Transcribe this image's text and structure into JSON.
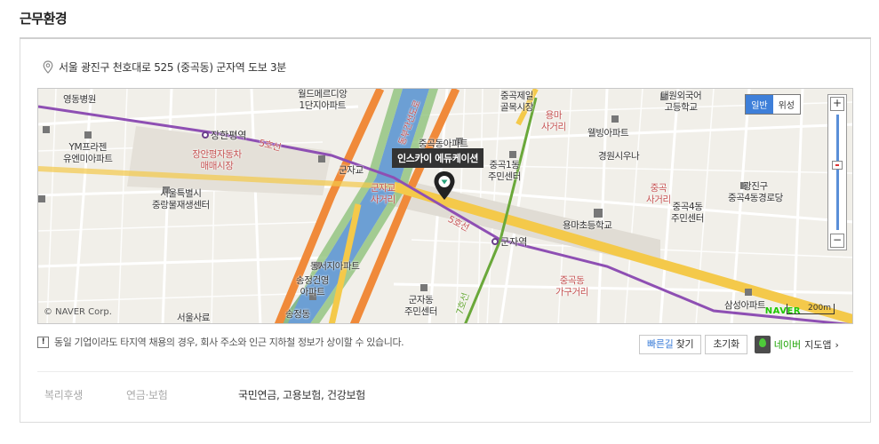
{
  "section": {
    "title": "근무환경"
  },
  "location": {
    "address": "서울 광진구 천호대로 525 (중곡동) 군자역 도보 3분"
  },
  "map": {
    "marker_label": "인스카이 에듀케이션",
    "copyright": "© NAVER Corp.",
    "map_type": {
      "normal": "일반",
      "satellite": "위성"
    },
    "zoom": {
      "plus": "+",
      "minus": "−"
    },
    "logo": "NAVER",
    "scale": "200m",
    "line_label": "5호선",
    "line_label_2": "7호선",
    "road_label": "동부간선도로",
    "pois": [
      {
        "text": "영동병원"
      },
      {
        "text": "YM프라젠\n유엔미아파트"
      },
      {
        "text": "서울특별시\n중랑물재생센터"
      },
      {
        "text": "월드메르디앙\n1단지아파트"
      },
      {
        "text": "중곡제일\n골목시장"
      },
      {
        "text": "용마\n사거리"
      },
      {
        "text": "웰빙아파트"
      },
      {
        "text": "대원외국어\n고등학교"
      },
      {
        "text": "중곡동아파트"
      },
      {
        "text": "중곡1동\n주민센터"
      },
      {
        "text": "경원시우나"
      },
      {
        "text": "중곡\n사거리"
      },
      {
        "text": "광진구\n중곡4동경로당"
      },
      {
        "text": "중곡4동\n주민센터"
      },
      {
        "text": "용마초등학교"
      },
      {
        "text": "군자교"
      },
      {
        "text": "군자교\n사거리"
      },
      {
        "text": "장안평자동차\n매매시장"
      },
      {
        "text": "송정건영\n아파트"
      },
      {
        "text": "동서지아파트"
      },
      {
        "text": "군자동\n주민센터"
      },
      {
        "text": "송정동"
      },
      {
        "text": "중곡동\n가구거리"
      },
      {
        "text": "삼성아파트"
      },
      {
        "text": "서울사료"
      }
    ],
    "stations": [
      {
        "name": "장한평역"
      },
      {
        "name": "군자역"
      }
    ]
  },
  "notice": {
    "text": "동일 기업이라도 타지역 채용의 경우, 회사 주소와 인근 지하철 정보가 상이할 수 있습니다."
  },
  "actions": {
    "route_prefix": "빠른길",
    "route_suffix": " 찾기",
    "reset": "초기화",
    "app_brand": "네이버",
    "app_suffix": "지도앱",
    "chevron": "›"
  },
  "benefits": {
    "category": "복리후생",
    "subcategory": "연금·보험",
    "value": "국민연금, 고용보험, 건강보험"
  }
}
